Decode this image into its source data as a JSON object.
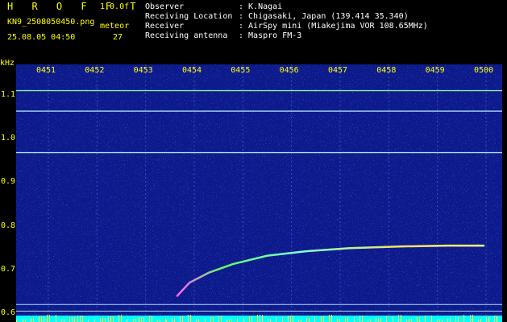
{
  "header": {
    "title": "H R O F F T",
    "version": "1.0.0f",
    "filename": "KN9_2508050450.png",
    "meteor_label": "meteor",
    "timestamp": "25.08.05 04:50",
    "meteor_count": "27",
    "info": [
      {
        "label": "Observer",
        "value": ": K.Nagai"
      },
      {
        "label": "Receiving Location",
        "value": ": Chigasaki, Japan (139.414 35.340)"
      },
      {
        "label": "Receiver",
        "value": ": AirSpy mini (Miakejima VOR 108.65MHz)"
      },
      {
        "label": "Receiving antenna",
        "value": ": Maspro FM-3"
      }
    ]
  },
  "colors": {
    "accent": "#ffff00",
    "background": "#0c1a8c",
    "trace": "#7fffd4"
  },
  "chart_data": {
    "type": "heatmap",
    "title": "",
    "xlabel": "",
    "ylabel": "kHz",
    "x_ticks": [
      "0451",
      "0452",
      "0453",
      "0454",
      "0455",
      "0456",
      "0457",
      "0458",
      "0459",
      "0500"
    ],
    "y_ticks": [
      "1.1",
      "1.0",
      "0.9",
      "0.8",
      "0.7",
      "0.6"
    ],
    "ylim": [
      0.58,
      1.17
    ],
    "carrier_lines_khz": [
      1.11,
      1.063,
      0.968,
      0.62,
      0.605
    ],
    "meteor_trace": {
      "x_minutes_from_0450": [
        3.65,
        3.9,
        4.3,
        4.8,
        5.5,
        6.3,
        7.2,
        8.2,
        9.2,
        9.95
      ],
      "y_khz": [
        0.64,
        0.67,
        0.693,
        0.713,
        0.732,
        0.742,
        0.749,
        0.753,
        0.755,
        0.755
      ]
    }
  }
}
